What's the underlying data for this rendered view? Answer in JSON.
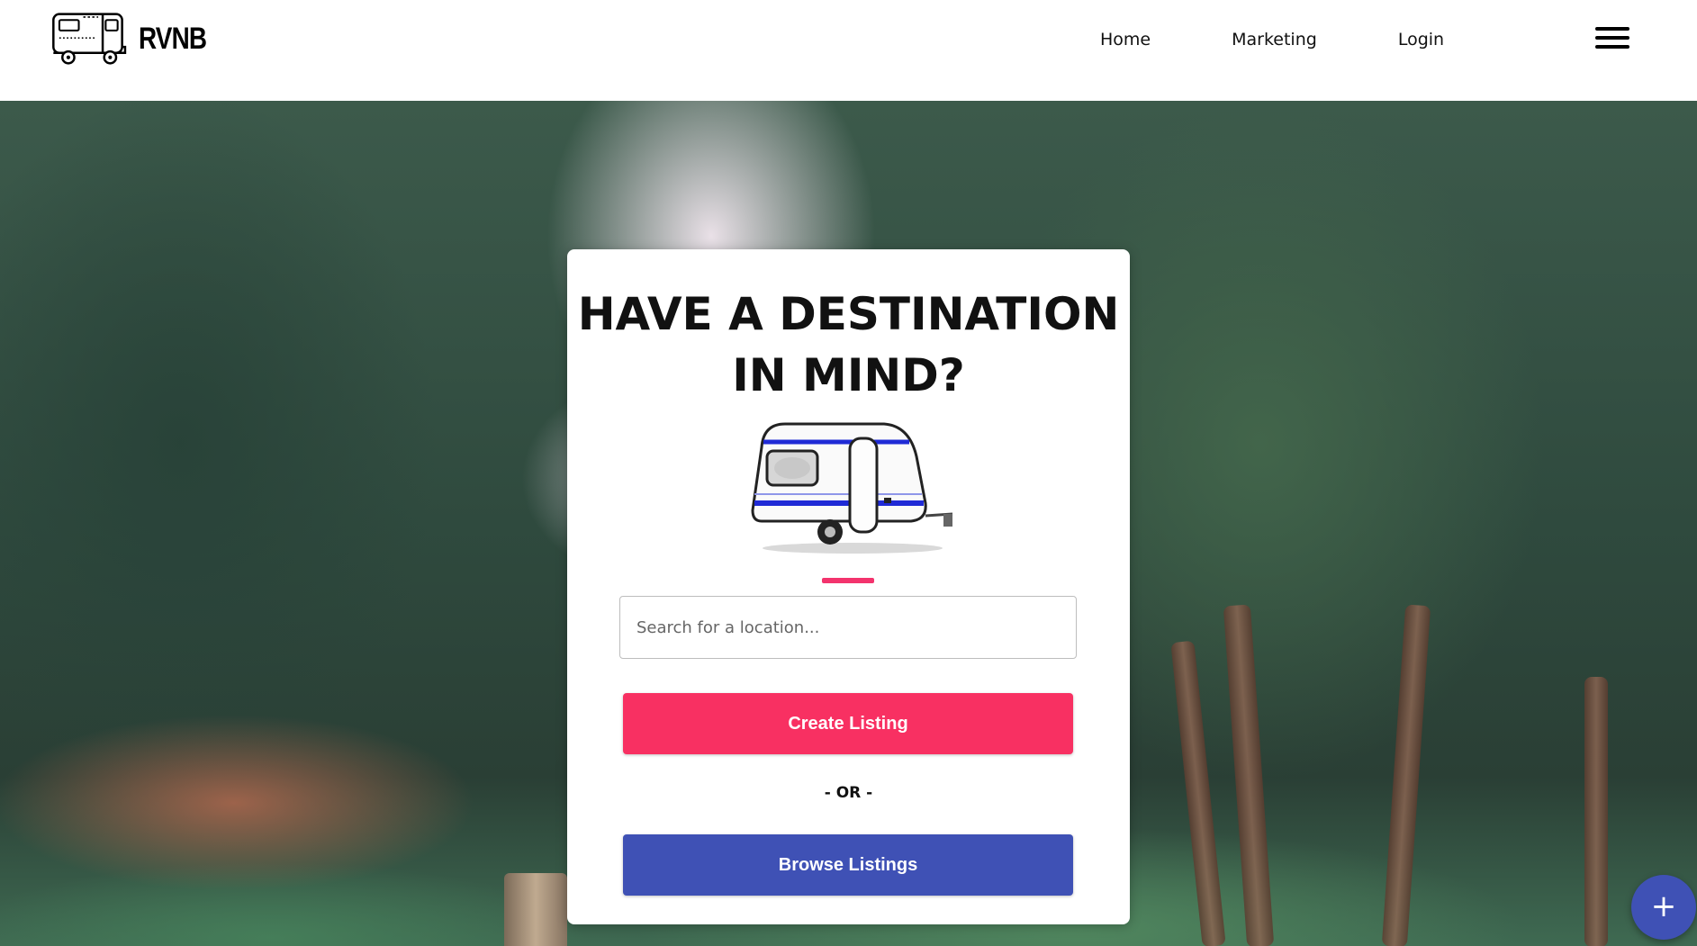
{
  "header": {
    "brand": "RVNB",
    "logo_icon": "rv-camper-icon",
    "nav": [
      {
        "label": "Home"
      },
      {
        "label": "Marketing"
      },
      {
        "label": "Login"
      }
    ],
    "menu_icon": "hamburger-menu-icon"
  },
  "hero": {
    "background": "forest-photo",
    "card": {
      "title": "HAVE A DESTINATION IN MIND?",
      "illustration": "camper-trailer-illustration",
      "search_placeholder": "Search for a location...",
      "search_value": "",
      "create_label": "Create Listing",
      "or_label": "- OR -",
      "browse_label": "Browse Listings"
    }
  },
  "fab": {
    "icon": "plus-icon",
    "label": "+"
  },
  "colors": {
    "accent_pink": "#f83062",
    "primary_indigo": "#3f51b5",
    "text": "#111111",
    "card_bg": "#ffffff"
  }
}
